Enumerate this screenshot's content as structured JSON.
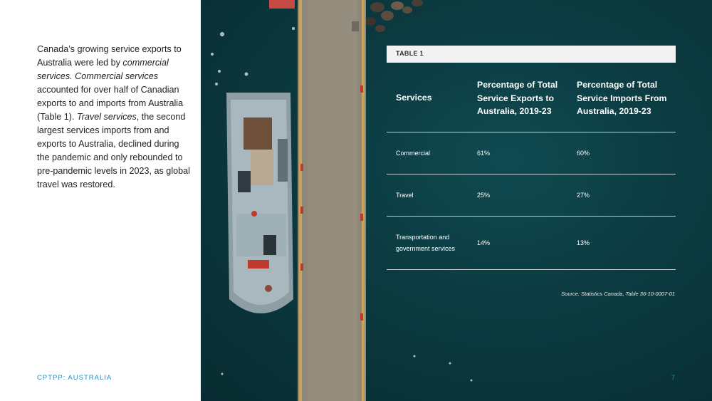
{
  "intro": {
    "part1": "Canada’s growing service exports to Australia were led by ",
    "em1": "commercial services. Commercial services",
    "part2": " accounted for over half of Canadian exports to and imports from Australia (Table 1). ",
    "em2": "Travel services",
    "part3": ", the second largest services imports from and exports to Australia, declined during the pandemic and only rebounded to pre-pandemic levels in 2023, as global travel was restored."
  },
  "table": {
    "label": "TABLE 1",
    "headers": [
      "Services",
      "Percentage of Total Service Exports to Australia, 2019-23",
      "Percentage of Total Service Imports From Australia, 2019-23"
    ],
    "rows": [
      {
        "service": "Commercial",
        "exports": "61%",
        "imports": "60%"
      },
      {
        "service": "Travel",
        "exports": "25%",
        "imports": "27%"
      },
      {
        "service": "Transportation and government services",
        "exports": "14%",
        "imports": "13%"
      }
    ],
    "source": "Source: Statistics Canada, Table 36-10-0007-01"
  },
  "footer": {
    "label": "CPTPP: AUSTRALIA",
    "page_number": "7"
  },
  "colors": {
    "accent": "#1c8fc4",
    "water": "#0b3a40",
    "header_bar": "#f2f2f2"
  }
}
